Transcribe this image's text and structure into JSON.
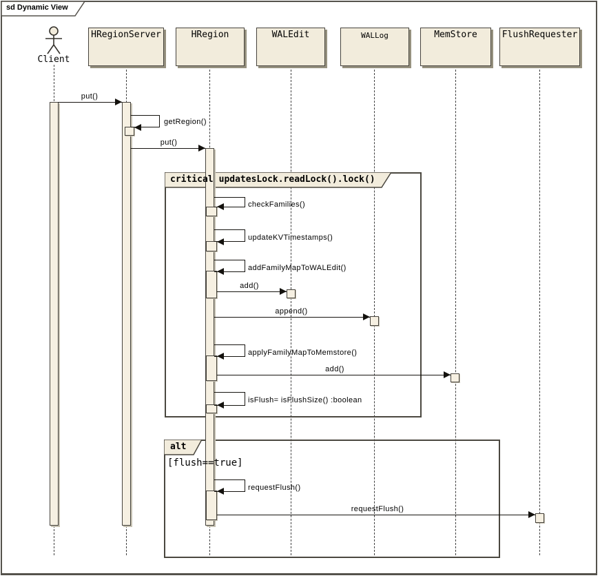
{
  "diagram": {
    "title": "sd Dynamic View"
  },
  "lifelines": [
    {
      "label": "Client",
      "kind": "actor"
    },
    {
      "label": "HRegionServer",
      "kind": "object"
    },
    {
      "label": "HRegion",
      "kind": "object"
    },
    {
      "label": "WALEdit",
      "kind": "object"
    },
    {
      "label": "WALLog",
      "kind": "object"
    },
    {
      "label": "MemStore",
      "kind": "object"
    },
    {
      "label": "FlushRequester",
      "kind": "object"
    }
  ],
  "fragments": [
    {
      "operator": "critical",
      "condition": "updatesLock.readLock().lock()"
    },
    {
      "operator": "alt",
      "guard": "[flush==true]"
    }
  ],
  "messages": {
    "put1": "put()",
    "getRegion": "getRegion()",
    "put2": "put()",
    "checkFamilies": "checkFamilies()",
    "updateKVTimestamps": "updateKVTimestamps()",
    "addFamilyMapToWALEdit": "addFamilyMapToWALEdit()",
    "addToWALEdit": "add()",
    "append": "append()",
    "applyFamilyMapToMemstore": "applyFamilyMapToMemstore()",
    "addToMemStore": "add()",
    "isFlush": "isFlush= isFlushSize() :boolean",
    "requestFlushSelf": "requestFlush()",
    "requestFlushRemote": "requestFlush()"
  },
  "colors": {
    "box_fill": "#F2ECDC",
    "activation_fill": "#F6F0E2",
    "border": "#45423C",
    "shadow": "#96917F",
    "line": "#14120E"
  }
}
